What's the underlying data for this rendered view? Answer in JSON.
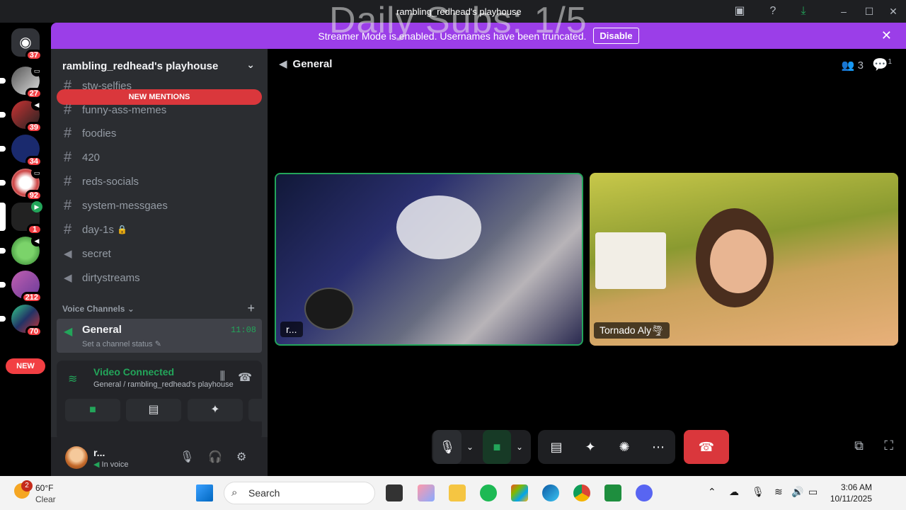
{
  "window": {
    "title": "rambling_redhead's playhouse",
    "overlay_text": "Daily Subs: 1/5"
  },
  "rail": {
    "servers": [
      {
        "badge": "37"
      },
      {
        "badge": "27"
      },
      {
        "badge": "39"
      },
      {
        "badge": "34"
      },
      {
        "badge": "92"
      },
      {
        "badge": "1"
      },
      {
        "badge": ""
      },
      {
        "badge": "212"
      },
      {
        "badge": "70"
      }
    ],
    "new_label": "NEW"
  },
  "banner": {
    "text": "Streamer Mode is enabled. Usernames have been truncated.",
    "button": "Disable"
  },
  "sidebar": {
    "guild_name": "rambling_redhead's playhouse",
    "new_mentions": "NEW MENTIONS",
    "channels": [
      {
        "name": "stw-selfies",
        "type": "text"
      },
      {
        "name": "funny-ass-memes",
        "type": "text"
      },
      {
        "name": "foodies",
        "type": "text"
      },
      {
        "name": "420",
        "type": "text"
      },
      {
        "name": "reds-socials",
        "type": "text"
      },
      {
        "name": "system-messgaes",
        "type": "text"
      },
      {
        "name": "day-1s",
        "type": "text"
      },
      {
        "name": "secret",
        "type": "voice"
      },
      {
        "name": "dirtystreams",
        "type": "voice"
      }
    ],
    "voice_header": "Voice Channels",
    "voice_channel": {
      "name": "General",
      "status": "Set a channel status",
      "time": "11:08"
    }
  },
  "voice_panel": {
    "title": "Video Connected",
    "subtitle": "General / rambling_redhead's playhouse"
  },
  "user": {
    "name": "r...",
    "status": "In voice"
  },
  "stage": {
    "channel": "General",
    "people_count": "3",
    "threads_count": "1",
    "tiles": [
      {
        "label": "r..."
      },
      {
        "label": "Tornado Aly🌪"
      }
    ]
  },
  "taskbar": {
    "weather_badge": "2",
    "temperature": "60°F",
    "condition": "Clear",
    "search_placeholder": "Search",
    "time": "3:06 AM",
    "date": "10/11/2025"
  }
}
